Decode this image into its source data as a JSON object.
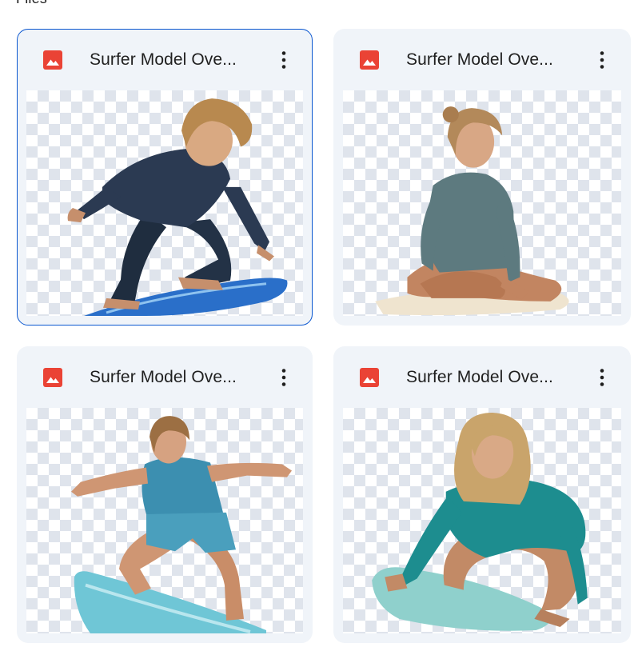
{
  "section": {
    "label": "Files"
  },
  "files": [
    {
      "name": "Surfer Model Ove...",
      "icon": "image-file-icon",
      "selected": true,
      "thumbnail": "surfer-boy-wetsuit-crouching"
    },
    {
      "name": "Surfer Model Ove...",
      "icon": "image-file-icon",
      "selected": false,
      "thumbnail": "surfer-girl-sitting-on-board"
    },
    {
      "name": "Surfer Model Ove...",
      "icon": "image-file-icon",
      "selected": false,
      "thumbnail": "surfer-girl-riding-stance"
    },
    {
      "name": "Surfer Model Ove...",
      "icon": "image-file-icon",
      "selected": false,
      "thumbnail": "surfer-girl-crouching-teal-suit"
    }
  ],
  "colors": {
    "card_background": "#f0f4f9",
    "selected_border": "#0b57d0",
    "image_icon": "#ea4335",
    "text": "#1f1f1f"
  }
}
